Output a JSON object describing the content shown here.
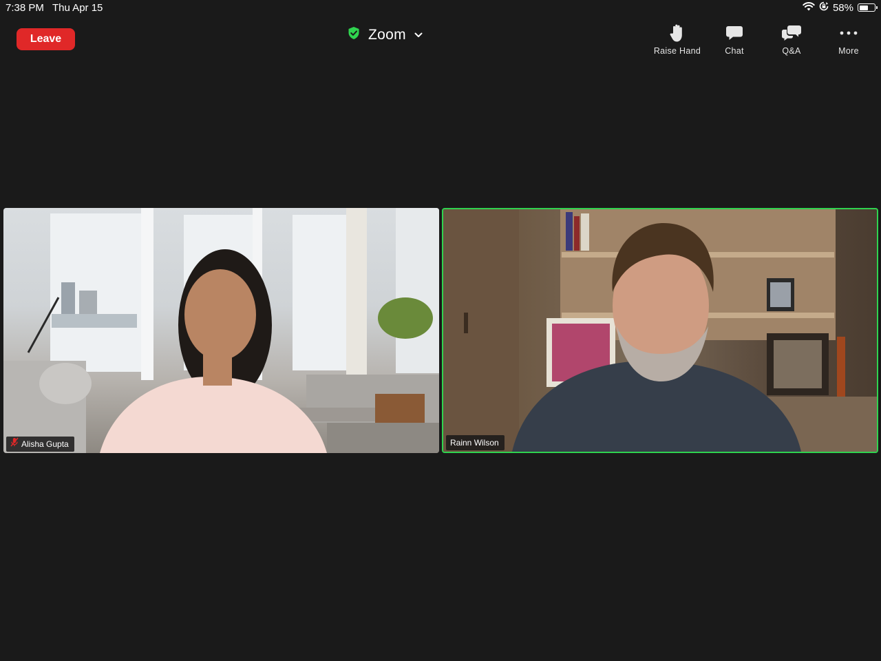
{
  "status_bar": {
    "time": "7:38 PM",
    "date": "Thu Apr 15",
    "battery_percent_text": "58%",
    "battery_level": 0.58,
    "icons": [
      "wifi-icon",
      "orientation-lock-icon",
      "battery-icon"
    ]
  },
  "toolbar": {
    "leave_label": "Leave",
    "meeting_title": "Zoom",
    "security_icon": "shield-check-icon",
    "dropdown_icon": "chevron-down-icon",
    "actions": [
      {
        "label": "Raise Hand",
        "icon": "raise-hand-icon"
      },
      {
        "label": "Chat",
        "icon": "chat-icon"
      },
      {
        "label": "Q&A",
        "icon": "qa-icon"
      },
      {
        "label": "More",
        "icon": "more-icon"
      }
    ]
  },
  "participants": [
    {
      "name": "Alisha Gupta",
      "muted": true,
      "active_speaker": false
    },
    {
      "name": "Rainn Wilson",
      "muted": false,
      "active_speaker": true
    }
  ],
  "colors": {
    "background": "#1a1a1a",
    "leave_button": "#e02828",
    "active_speaker_border": "#2fd34f",
    "secure_shield": "#2fd34f",
    "muted_icon": "#e02828"
  }
}
